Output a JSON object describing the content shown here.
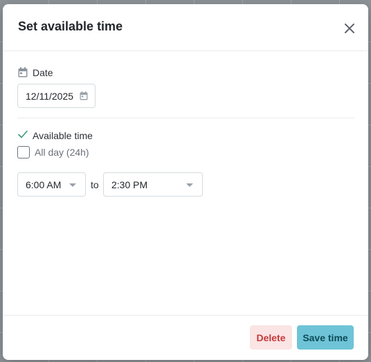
{
  "modal": {
    "title": "Set available time"
  },
  "date_field": {
    "label": "Date",
    "value": "12/11/2025"
  },
  "availability": {
    "label": "Available time",
    "all_day_label": "All day (24h)",
    "all_day_checked": false,
    "start_time": "6:00 AM",
    "separator": "to",
    "end_time": "2:30 PM"
  },
  "footer": {
    "delete_label": "Delete",
    "save_label": "Save time"
  },
  "colors": {
    "save_bg": "#6ec4d6",
    "delete_bg": "#fbe4e4",
    "delete_text": "#c43a3a",
    "check_green": "#3a9a78"
  }
}
